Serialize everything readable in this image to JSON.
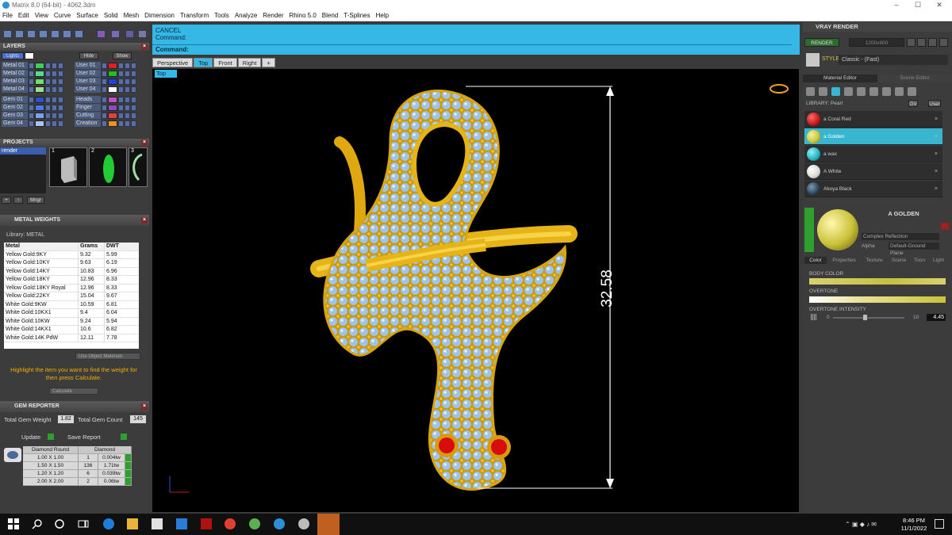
{
  "window": {
    "title": "Matrix 8.0 (64-bit) - 4062.3dm",
    "minimize": "–",
    "maximize": "☐",
    "close": "✕"
  },
  "menu": [
    "File",
    "Edit",
    "View",
    "Curve",
    "Surface",
    "Solid",
    "Mesh",
    "Dimension",
    "Transform",
    "Tools",
    "Analyze",
    "Render",
    "Rhino 5.0",
    "Blend",
    "T-Splines",
    "Help"
  ],
  "layers": {
    "title": "LAYERS",
    "current": "Lights",
    "hide": "Hide",
    "show": "Show",
    "left": [
      {
        "name": "Metal 01",
        "color": "#3ecf5a"
      },
      {
        "name": "Metal 02",
        "color": "#59d88f"
      },
      {
        "name": "Metal 03",
        "color": "#6be06b"
      },
      {
        "name": "Metal 04",
        "color": "#9de08c"
      },
      {
        "name": "Gem 01",
        "color": "#2f4fc9"
      },
      {
        "name": "Gem 02",
        "color": "#4a78e8"
      },
      {
        "name": "Gem 03",
        "color": "#7aa3ef"
      },
      {
        "name": "Gem 04",
        "color": "#a8c4f2"
      }
    ],
    "right": [
      {
        "name": "User 01",
        "color": "#e02020"
      },
      {
        "name": "User 02",
        "color": "#20c020"
      },
      {
        "name": "User 03",
        "color": "#2040e0"
      },
      {
        "name": "User 04",
        "color": "#ffffff"
      },
      {
        "name": "Heads",
        "color": "#c050c0"
      },
      {
        "name": "Finger",
        "color": "#8a4cc0"
      },
      {
        "name": "Cutting",
        "color": "#e04040"
      },
      {
        "name": "Creation",
        "color": "#f09020"
      }
    ]
  },
  "projects": {
    "title": "PROJECTS",
    "item": "render",
    "thumbs": [
      "1",
      "2",
      "3"
    ],
    "mngr": "Mngr"
  },
  "metal_weights": {
    "title": "METAL WEIGHTS",
    "library": "Library: METAL",
    "headers": [
      "Metal",
      "Grams",
      "DWT"
    ],
    "rows": [
      [
        "Yellow Gold:9KY",
        "9.32",
        "5.99"
      ],
      [
        "Yellow Gold:10KY",
        "9.63",
        "6.19"
      ],
      [
        "Yellow Gold:14KY",
        "10.83",
        "6.96"
      ],
      [
        "Yellow Gold:18KY",
        "12.96",
        "8.33"
      ],
      [
        "Yellow Gold:18KY Royal",
        "12.96",
        "8.33"
      ],
      [
        "Yellow Gold:22KY",
        "15.04",
        "9.67"
      ],
      [
        "White Gold:9KW",
        "10.59",
        "6.81"
      ],
      [
        "White Gold:10KX1",
        "9.4",
        "6.04"
      ],
      [
        "White Gold:10KW",
        "9.24",
        "5.94"
      ],
      [
        "White Gold:14KX1",
        "10.6",
        "6.82"
      ],
      [
        "White Gold:14K PdW",
        "12.11",
        "7.78"
      ]
    ],
    "use_object_materials": "Use Object Materials",
    "hint": "Highlight the item you want to find the weight for then press Calculate.",
    "calculate": "Calculate"
  },
  "gem_reporter": {
    "title": "GEM REPORTER",
    "total_weight_label": "Total Gem Weight",
    "total_weight": "1.82",
    "total_count_label": "Total Gem Count",
    "total_count": "145",
    "update": "Update",
    "save_report": "Save Report",
    "headers": [
      "Diamond Round",
      "Diamond"
    ],
    "rows": [
      [
        "1.00 X 1.00",
        "1",
        "0.004tw"
      ],
      [
        "1.50 X 1.50",
        "136",
        "1.71tw"
      ],
      [
        "1.20 X 1.20",
        "6",
        "0.039tw"
      ],
      [
        "2.00 X 2.00",
        "2",
        "0.06tw"
      ]
    ]
  },
  "command": {
    "line1": "CANCEL",
    "line2": "Command:",
    "prompt": "Command:"
  },
  "viewport_tabs": [
    "Perspective",
    "Top",
    "Front",
    "Right",
    "+"
  ],
  "viewport": {
    "label": "Top",
    "dimension": "32.58"
  },
  "vray": {
    "title": "VRAY RENDER",
    "render": "RENDER",
    "resolution": "1200x900",
    "style_label": "STYLE:",
    "style_value": "Classic - (Fast)",
    "material_editor": "Material Editor",
    "scene_editor": "Scene Editor",
    "library": "LIBRARY: Pearl",
    "gv": "GV",
    "user": "User",
    "materials": [
      {
        "name": "a Coral Red",
        "color": "#c01818"
      },
      {
        "name": "a Golden",
        "color": "#c9c238"
      },
      {
        "name": "a wax",
        "color": "#1fb0c0"
      },
      {
        "name": "A White",
        "color": "#d8d8d8"
      },
      {
        "name": "Akoya Black",
        "color": "#2a3d50"
      }
    ],
    "selected_name": "A GOLDEN",
    "reflection": "Complex Reflection",
    "alpha": "Alpha",
    "ground": "Default-Ground Plane",
    "tabs": [
      "Color",
      "Properties",
      "Texture",
      "Scene",
      "Toon",
      "Light"
    ],
    "body_color": "BODY COLOR",
    "overtone": "OVERTONE",
    "overtone_intensity": "OVERTONE INTENSITY",
    "intensity_min": "0",
    "intensity_max": "10",
    "intensity_value": "4.45",
    "intensity_fraction": 0.445
  },
  "taskbar": {
    "time": "8:46 PM",
    "date": "11/1/2022"
  }
}
